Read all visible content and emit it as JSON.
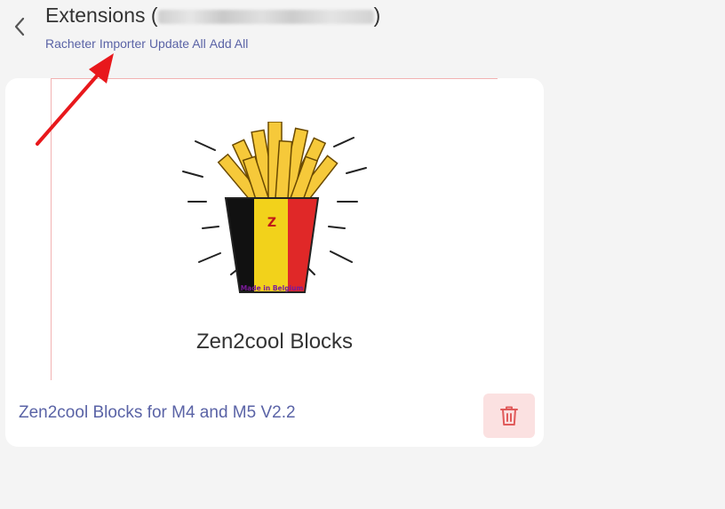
{
  "header": {
    "title_prefix": "Extensions (",
    "title_suffix": ")",
    "back_icon": "chevron-left-icon"
  },
  "actions": {
    "racheter": "Racheter",
    "importer": "Importer",
    "update_all": "Update All",
    "add_all": "Add All"
  },
  "extension": {
    "thumbnail_caption": "Zen2cool Blocks",
    "logo_text": "Made in Belgium",
    "logo_letter": "Z",
    "name": "Zen2cool Blocks for M4 and M5 V2.2",
    "delete_icon": "trash-icon"
  },
  "colors": {
    "link": "#5a63a6",
    "delete_bg": "#fbe1e1",
    "delete_icon": "#e05a5a",
    "annotation_arrow": "#e8181c"
  }
}
